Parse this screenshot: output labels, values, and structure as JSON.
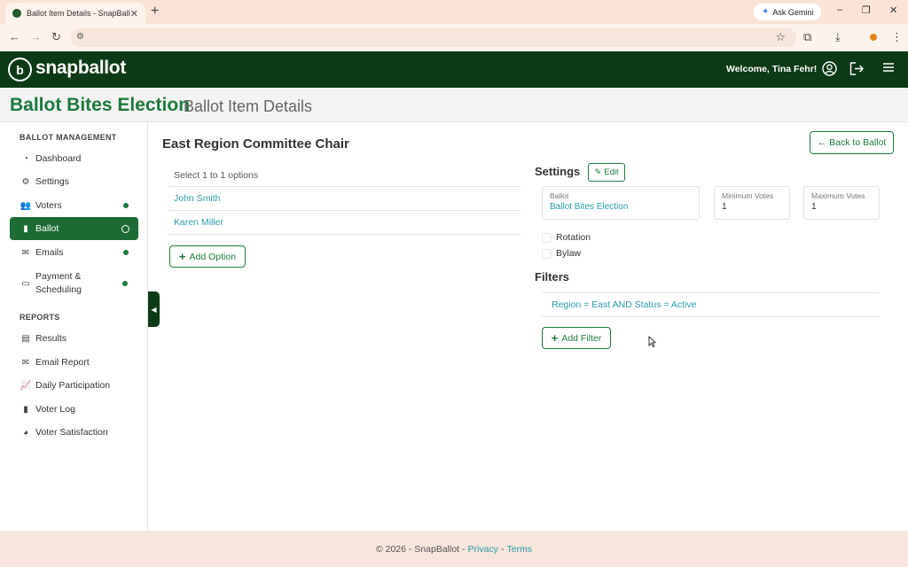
{
  "browser": {
    "tab_title": "Ballot Item Details - SnapBallot",
    "tab_close": "✕",
    "new_tab": "+",
    "ask_gemini": "Ask Gemini",
    "window_controls": {
      "minimize": "–",
      "restore": "❐",
      "close": "✕"
    }
  },
  "header": {
    "logo_mark": "b",
    "logo_snap": "snap",
    "logo_ballot": "ballot",
    "welcome": "Welcome, Tina Fehr!"
  },
  "page": {
    "election_title": "Ballot Bites Election",
    "page_subtitle": "Ballot Item Details"
  },
  "sidebar": {
    "section_ballot": "BALLOT MANAGEMENT",
    "section_reports": "REPORTS",
    "management_items": [
      {
        "label": "Dashboard",
        "icon": "dashboard-icon"
      },
      {
        "label": "Settings",
        "icon": "gear-icon"
      },
      {
        "label": "Voters",
        "icon": "users-icon"
      },
      {
        "label": "Ballot",
        "icon": "clipboard-icon"
      },
      {
        "label": "Emails",
        "icon": "envelope-icon"
      },
      {
        "label": "Payment & Scheduling",
        "icon": "credit-card-icon"
      }
    ],
    "report_items": [
      {
        "label": "Results",
        "icon": "inbox-icon"
      },
      {
        "label": "Email Report",
        "icon": "envelope-open-icon"
      },
      {
        "label": "Daily Participation",
        "icon": "chart-line-icon"
      },
      {
        "label": "Voter Log",
        "icon": "clipboard-list-icon"
      },
      {
        "label": "Voter Satisfaction",
        "icon": "pie-chart-icon"
      }
    ]
  },
  "item": {
    "title": "East Region Committee Chair",
    "back_label": "Back to Ballot",
    "select_hint": "Select 1 to 1 options",
    "options": [
      "John Smith",
      "Karen Miller"
    ],
    "add_option_label": "Add Option"
  },
  "settings": {
    "heading": "Settings",
    "edit_label": "Edit",
    "ballot_label": "Ballot",
    "ballot_value": "Ballot Bites Election",
    "min_label": "Minimum Votes",
    "min_value": "1",
    "max_label": "Maximum Votes",
    "max_value": "1",
    "rotation_label": "Rotation",
    "bylaw_label": "Bylaw"
  },
  "filters": {
    "heading": "Filters",
    "rule": "Region = East AND Status = Active",
    "add_filter_label": "Add Filter"
  },
  "footer": {
    "copyright": "© 2026 - SnapBallot -",
    "privacy": "Privacy",
    "separator": "-",
    "terms": "Terms"
  },
  "colors": {
    "brand_dark": "#0d3a16",
    "brand_green": "#1d7a3d",
    "link_teal": "#2a9ba8"
  }
}
